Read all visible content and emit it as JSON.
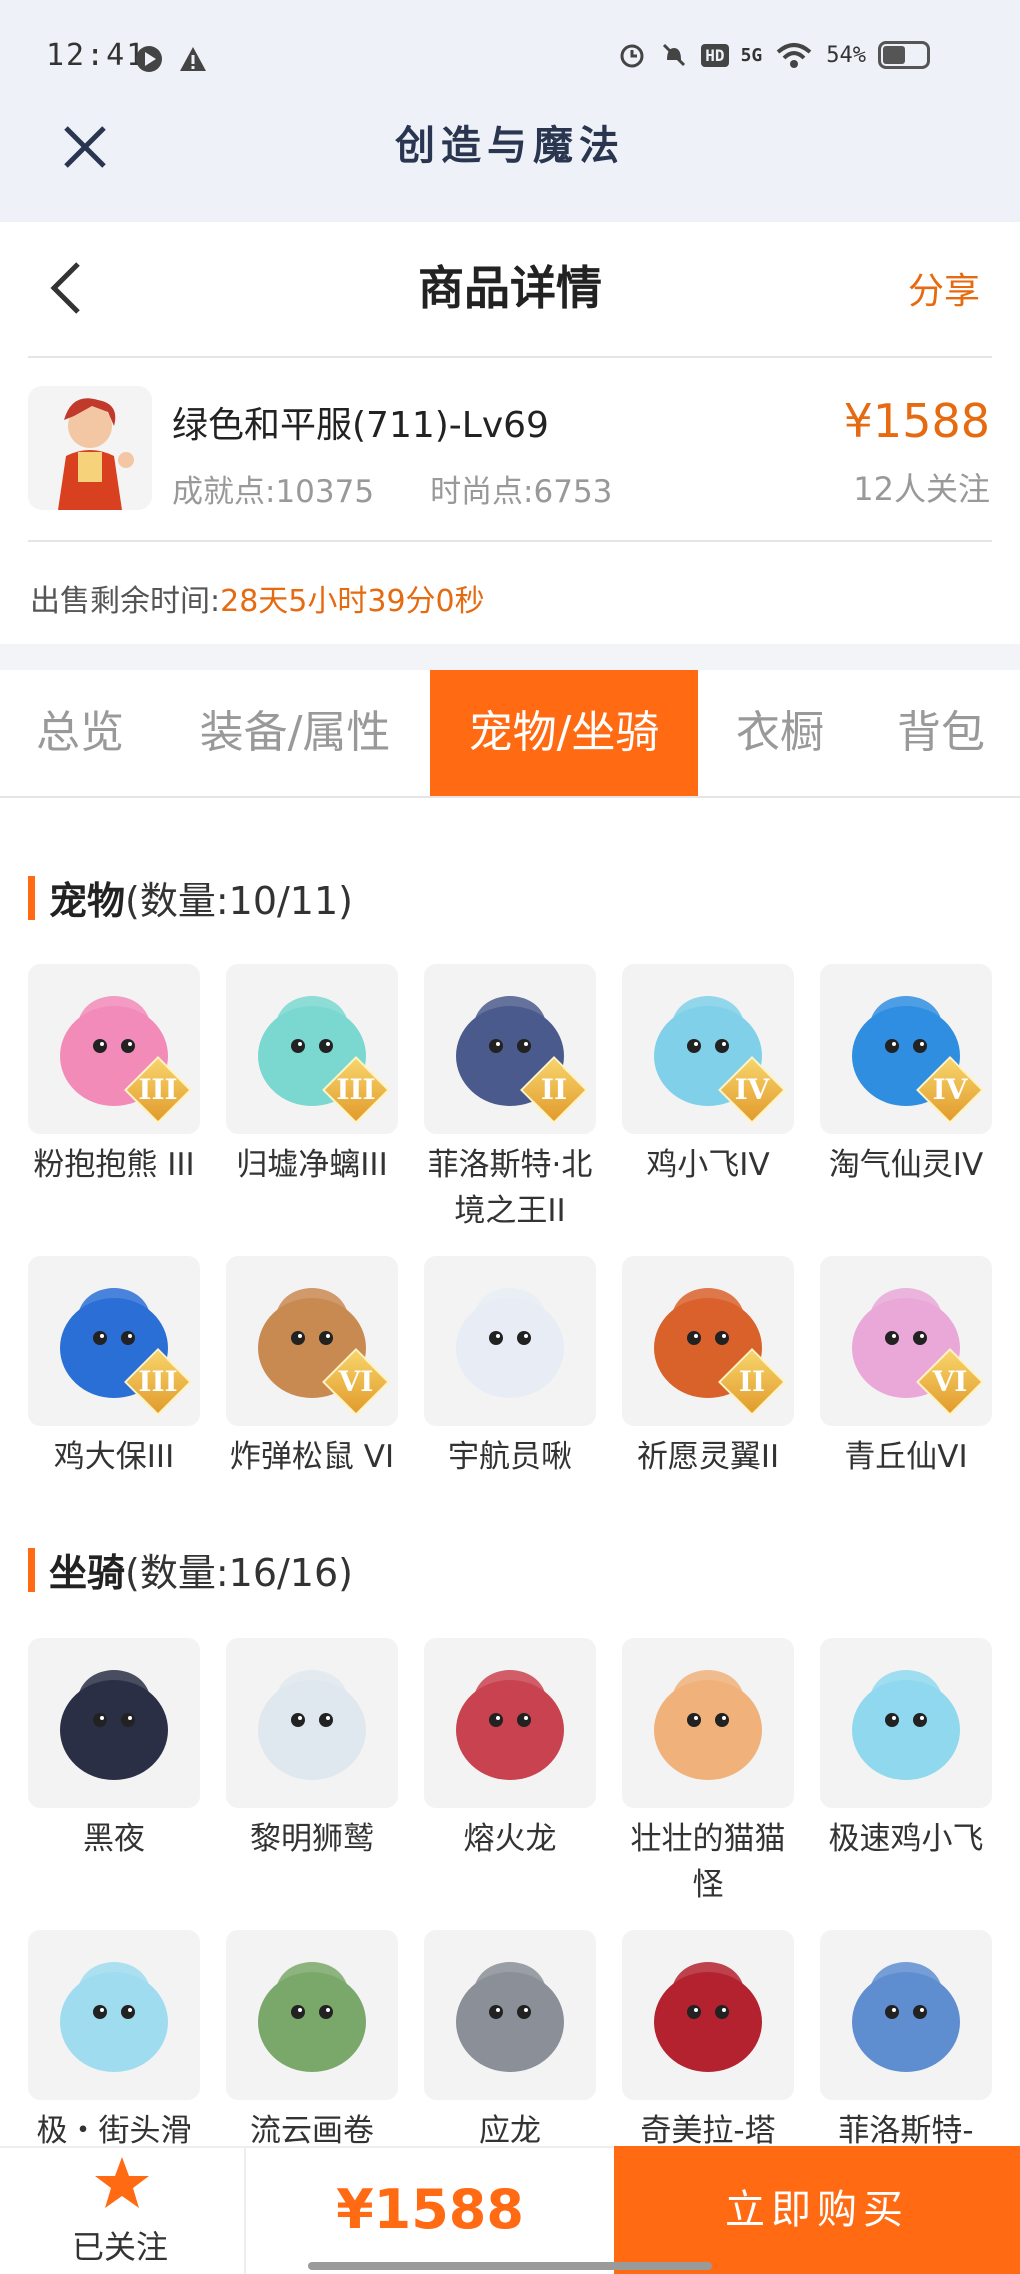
{
  "status_bar": {
    "time": "12:41",
    "battery": "54%",
    "network": "5G",
    "hd": "HD"
  },
  "app": {
    "title": "创造与魔法"
  },
  "nav": {
    "title": "商品详情",
    "share": "分享"
  },
  "product": {
    "name": "绿色和平服(711)-Lv69",
    "achievement": "成就点:10375",
    "fashion": "时尚点:6753",
    "price": "¥1588",
    "followers": "12人关注"
  },
  "sale": {
    "label": "出售剩余时间:",
    "value": "28天5小时39分0秒"
  },
  "tabs": [
    {
      "label": "总览",
      "active": false
    },
    {
      "label": "装备/属性",
      "active": false
    },
    {
      "label": "宠物/坐骑",
      "active": true
    },
    {
      "label": "衣橱",
      "active": false
    },
    {
      "label": "背包",
      "active": false
    }
  ],
  "pets": {
    "title": "宠物",
    "count": "(数量:10/11)",
    "items": [
      {
        "name": "粉抱抱熊 III",
        "badge": "III",
        "color": "#f28bb8"
      },
      {
        "name": "归墟净螭III",
        "badge": "III",
        "color": "#7ad8d0"
      },
      {
        "name": "菲洛斯特·北境之王II",
        "badge": "II",
        "color": "#4a5a8c"
      },
      {
        "name": "鸡小飞IV",
        "badge": "IV",
        "color": "#7fd0e8"
      },
      {
        "name": "淘气仙灵IV",
        "badge": "IV",
        "color": "#2f8ee0"
      },
      {
        "name": "鸡大保III",
        "badge": "III",
        "color": "#2a6fd6"
      },
      {
        "name": "炸弹松鼠 VI",
        "badge": "VI",
        "color": "#c98a52"
      },
      {
        "name": "宇航员啾",
        "badge": "",
        "color": "#e8ecf4"
      },
      {
        "name": "祈愿灵翼II",
        "badge": "II",
        "color": "#d9622b"
      },
      {
        "name": "青丘仙VI",
        "badge": "VI",
        "color": "#e9a8d8"
      }
    ]
  },
  "mounts": {
    "title": "坐骑",
    "count": "(数量:16/16)",
    "items": [
      {
        "name": "黑夜",
        "color": "#2a2f45"
      },
      {
        "name": "黎明狮鹫",
        "color": "#dfe8ee"
      },
      {
        "name": "熔火龙",
        "color": "#c9424f"
      },
      {
        "name": "壮壮的猫猫怪",
        "color": "#f0b27a"
      },
      {
        "name": "极速鸡小飞",
        "color": "#8fd8ee"
      },
      {
        "name": "极・街头滑",
        "color": "#9fdcf0"
      },
      {
        "name": "流云画卷",
        "color": "#7aa86a"
      },
      {
        "name": "应龙",
        "color": "#8a8f98"
      },
      {
        "name": "奇美拉-塔",
        "color": "#b3222e"
      },
      {
        "name": "菲洛斯特-",
        "color": "#5f8ed0"
      }
    ]
  },
  "bottom": {
    "follow_label": "已关注",
    "price": "¥1588",
    "buy_label": "立即购买"
  },
  "colors": {
    "accent": "#ff6a13",
    "price": "#e66a10"
  }
}
